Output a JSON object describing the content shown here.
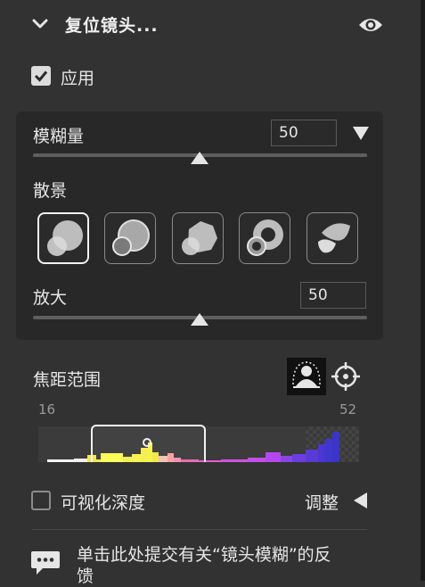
{
  "header": {
    "title": "复位镜头...",
    "collapse_icon": "chevron-down-icon",
    "visibility_icon": "eye-icon"
  },
  "apply": {
    "label": "应用",
    "checked": true
  },
  "blur": {
    "label": "模糊量",
    "value": "50",
    "slider_fraction": 0.5,
    "menu_icon": "triangle-down-icon"
  },
  "bokeh": {
    "label": "散景",
    "options": [
      "bokeh-circle",
      "bokeh-soap-bubble",
      "bokeh-blade",
      "bokeh-ring",
      "bokeh-cat-eye"
    ],
    "selected_index": 0
  },
  "magnify": {
    "label": "放大",
    "value": "50",
    "slider_fraction": 0.5
  },
  "focal": {
    "label": "焦距范围",
    "min": "16",
    "max": "52",
    "subject_icon": "focus-subject-icon",
    "target_icon": "crosshair-icon",
    "selection_range": [
      0.165,
      0.525
    ]
  },
  "visualize": {
    "label": "可视化深度",
    "checked": false
  },
  "adjust": {
    "label": "调整",
    "icon": "triangle-left-icon"
  },
  "feedback": {
    "text": "单击此处提交有关“镜头模糊”的反馈",
    "icon": "speech-bubble-icon"
  },
  "colors": {
    "background": "#323232",
    "panel": "#282828",
    "text": "#e6e6e6"
  }
}
